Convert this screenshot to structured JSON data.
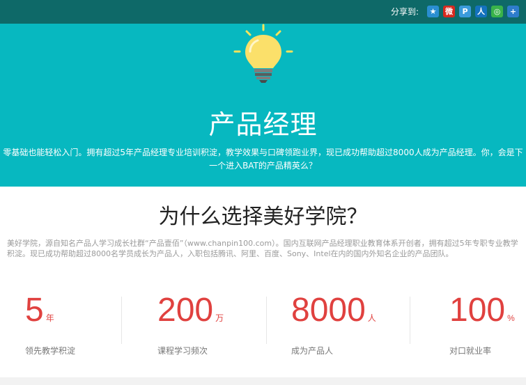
{
  "share": {
    "label": "分享到:",
    "icons": [
      {
        "name": "qzone-icon",
        "glyph": "★"
      },
      {
        "name": "weibo-icon",
        "glyph": "微"
      },
      {
        "name": "tencent-weibo-icon",
        "glyph": "P"
      },
      {
        "name": "renren-icon",
        "glyph": "人"
      },
      {
        "name": "wechat-icon",
        "glyph": "◎"
      },
      {
        "name": "more-share-icon",
        "glyph": "+"
      }
    ]
  },
  "hero": {
    "title": "产品经理",
    "description": "零基础也能轻松入门。拥有超过5年产品经理专业培训积淀，教学效果与口碑领跑业界，现已成功帮助超过8000人成为产品经理。你，会是下一个进入BAT的产品精英么？"
  },
  "why": {
    "title": "为什么选择美好学院？",
    "description": "美好学院，源自知名产品人学习成长社群“产品壹佰”（www.chanpin100.com）。国内互联网产品经理职业教育体系开创者，拥有超过5年专职专业教学积淀。现已成功帮助超过8000名学员成长为产品人，入职包括腾讯、阿里、百度、Sony、Intel在内的国内外知名企业的产品团队。"
  },
  "stats": [
    {
      "number": "5",
      "unit": "年",
      "label": "领先教学积淀"
    },
    {
      "number": "200",
      "unit": "万",
      "label": "课程学习频次"
    },
    {
      "number": "8000",
      "unit": "人",
      "label": "成为产品人"
    },
    {
      "number": "100",
      "unit": "%",
      "label": "对口就业率"
    }
  ],
  "colors": {
    "topbar": "#0e6968",
    "hero": "#07b8c0",
    "accent": "#e0413f"
  }
}
